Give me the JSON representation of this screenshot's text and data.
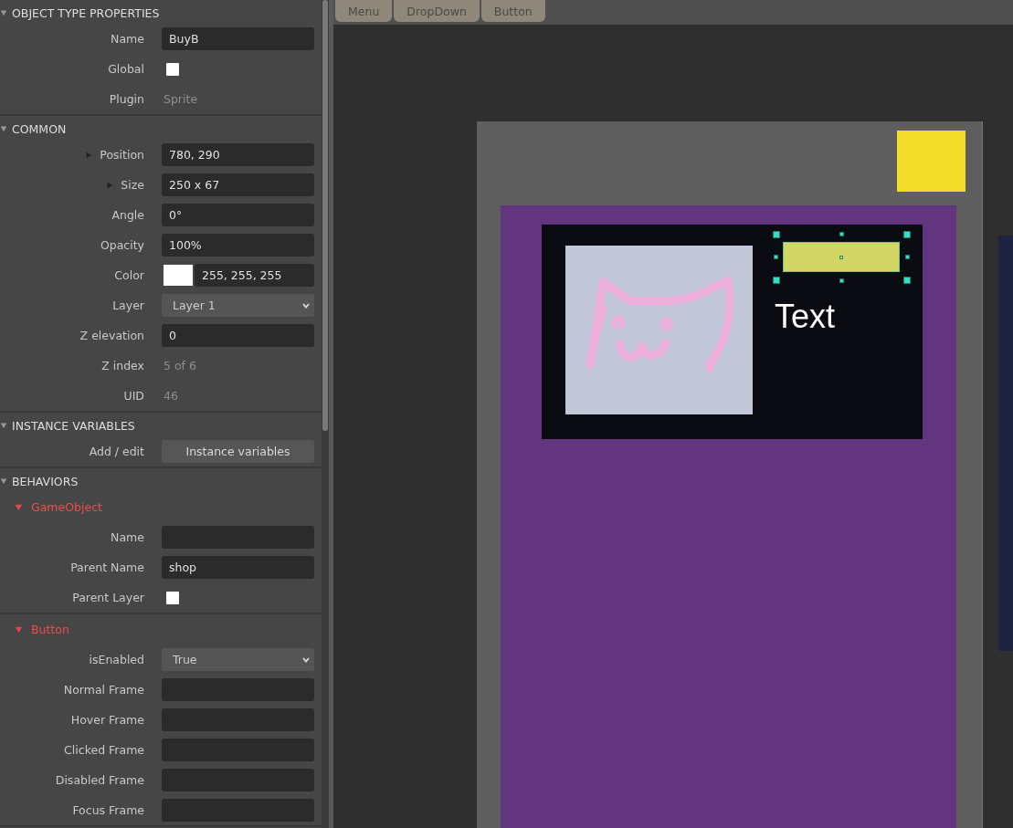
{
  "properties": {
    "sections": [
      {
        "title": "OBJECT TYPE PROPERTIES",
        "expanded": true,
        "items": [
          {
            "kind": "text",
            "label": "Name",
            "value": "BuyB"
          },
          {
            "kind": "checkbox",
            "label": "Global",
            "checked": false
          },
          {
            "kind": "readonly",
            "label": "Plugin",
            "value": "Sprite"
          }
        ]
      },
      {
        "title": "COMMON",
        "expanded": true,
        "items": [
          {
            "kind": "text",
            "label": "Position",
            "value": "780, 290",
            "expandable": true
          },
          {
            "kind": "text",
            "label": "Size",
            "value": "250 x 67",
            "expandable": true
          },
          {
            "kind": "text",
            "label": "Angle",
            "value": "0°"
          },
          {
            "kind": "text",
            "label": "Opacity",
            "value": "100%"
          },
          {
            "kind": "color",
            "label": "Color",
            "value": "255, 255, 255",
            "color": "#ffffff"
          },
          {
            "kind": "select",
            "label": "Layer",
            "value": "Layer 1"
          },
          {
            "kind": "text",
            "label": "Z elevation",
            "value": "0"
          },
          {
            "kind": "readonly",
            "label": "Z index",
            "value": "5 of 6"
          },
          {
            "kind": "readonly",
            "label": "UID",
            "value": "46"
          }
        ]
      },
      {
        "title": "INSTANCE VARIABLES",
        "expanded": true,
        "items": [
          {
            "kind": "button",
            "label": "Add / edit",
            "value": "Instance variables"
          }
        ]
      },
      {
        "title": "BEHAVIORS",
        "expanded": true,
        "items": [
          {
            "kind": "behavior",
            "label": "GameObject",
            "expanded": true,
            "rows": [
              {
                "kind": "text",
                "label": "Name"
              },
              {
                "kind": "text",
                "label": "Parent Name",
                "value": "shop"
              },
              {
                "kind": "checkbox",
                "label": "Parent Layer",
                "checked": false
              }
            ]
          },
          {
            "kind": "behavior",
            "label": "Button",
            "expanded": true,
            "rows": [
              {
                "kind": "select",
                "label": "isEnabled",
                "value": "True"
              },
              {
                "kind": "text",
                "label": "Normal Frame"
              },
              {
                "kind": "text",
                "label": "Hover Frame"
              },
              {
                "kind": "text",
                "label": "Clicked Frame"
              },
              {
                "kind": "text",
                "label": "Disabled Frame"
              },
              {
                "kind": "text",
                "label": "Focus Frame"
              }
            ]
          }
        ]
      }
    ]
  },
  "layout_tabs": [
    {
      "label": "Menu"
    },
    {
      "label": "DropDown"
    },
    {
      "label": "Button"
    }
  ],
  "canvas": {
    "text_object": "Text"
  }
}
